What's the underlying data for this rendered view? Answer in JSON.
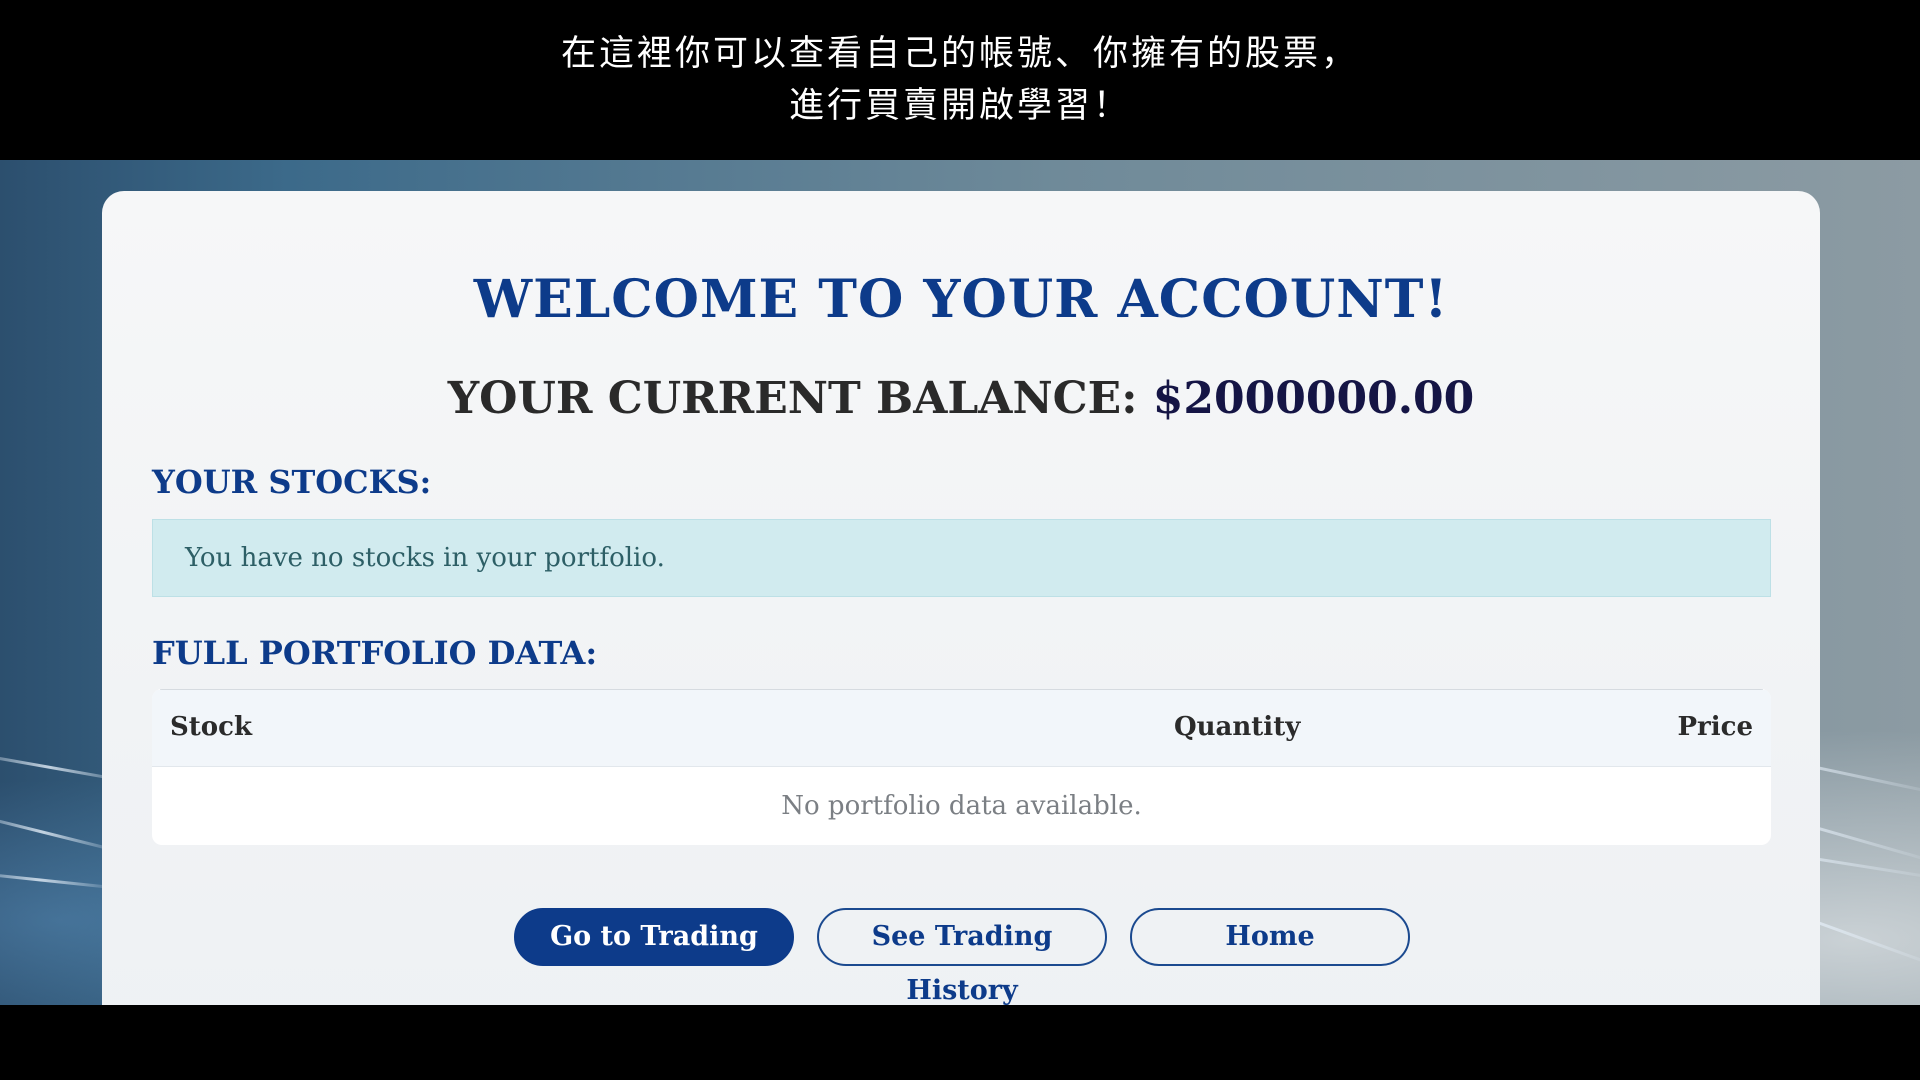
{
  "caption": {
    "line1": "在這裡你可以查看自己的帳號、你擁有的股票，",
    "line2": "進行買賣開啟學習！"
  },
  "account": {
    "welcome_title": "WELCOME TO YOUR ACCOUNT!",
    "balance_label": "YOUR CURRENT BALANCE:",
    "balance_value": "$2000000.00"
  },
  "stocks": {
    "section_title": "YOUR STOCKS:",
    "empty_message": "You have no stocks in your portfolio."
  },
  "portfolio": {
    "section_title": "FULL PORTFOLIO DATA:",
    "columns": [
      "Stock",
      "Quantity",
      "Price"
    ],
    "empty_message": "No portfolio data available."
  },
  "actions": {
    "go_trading": "Go to Trading",
    "trading_history": "See Trading History",
    "home": "Home"
  },
  "colors": {
    "brand_blue": "#0d3b8a",
    "alert_bg": "#d1ebef",
    "alert_text": "#2d5f66"
  }
}
